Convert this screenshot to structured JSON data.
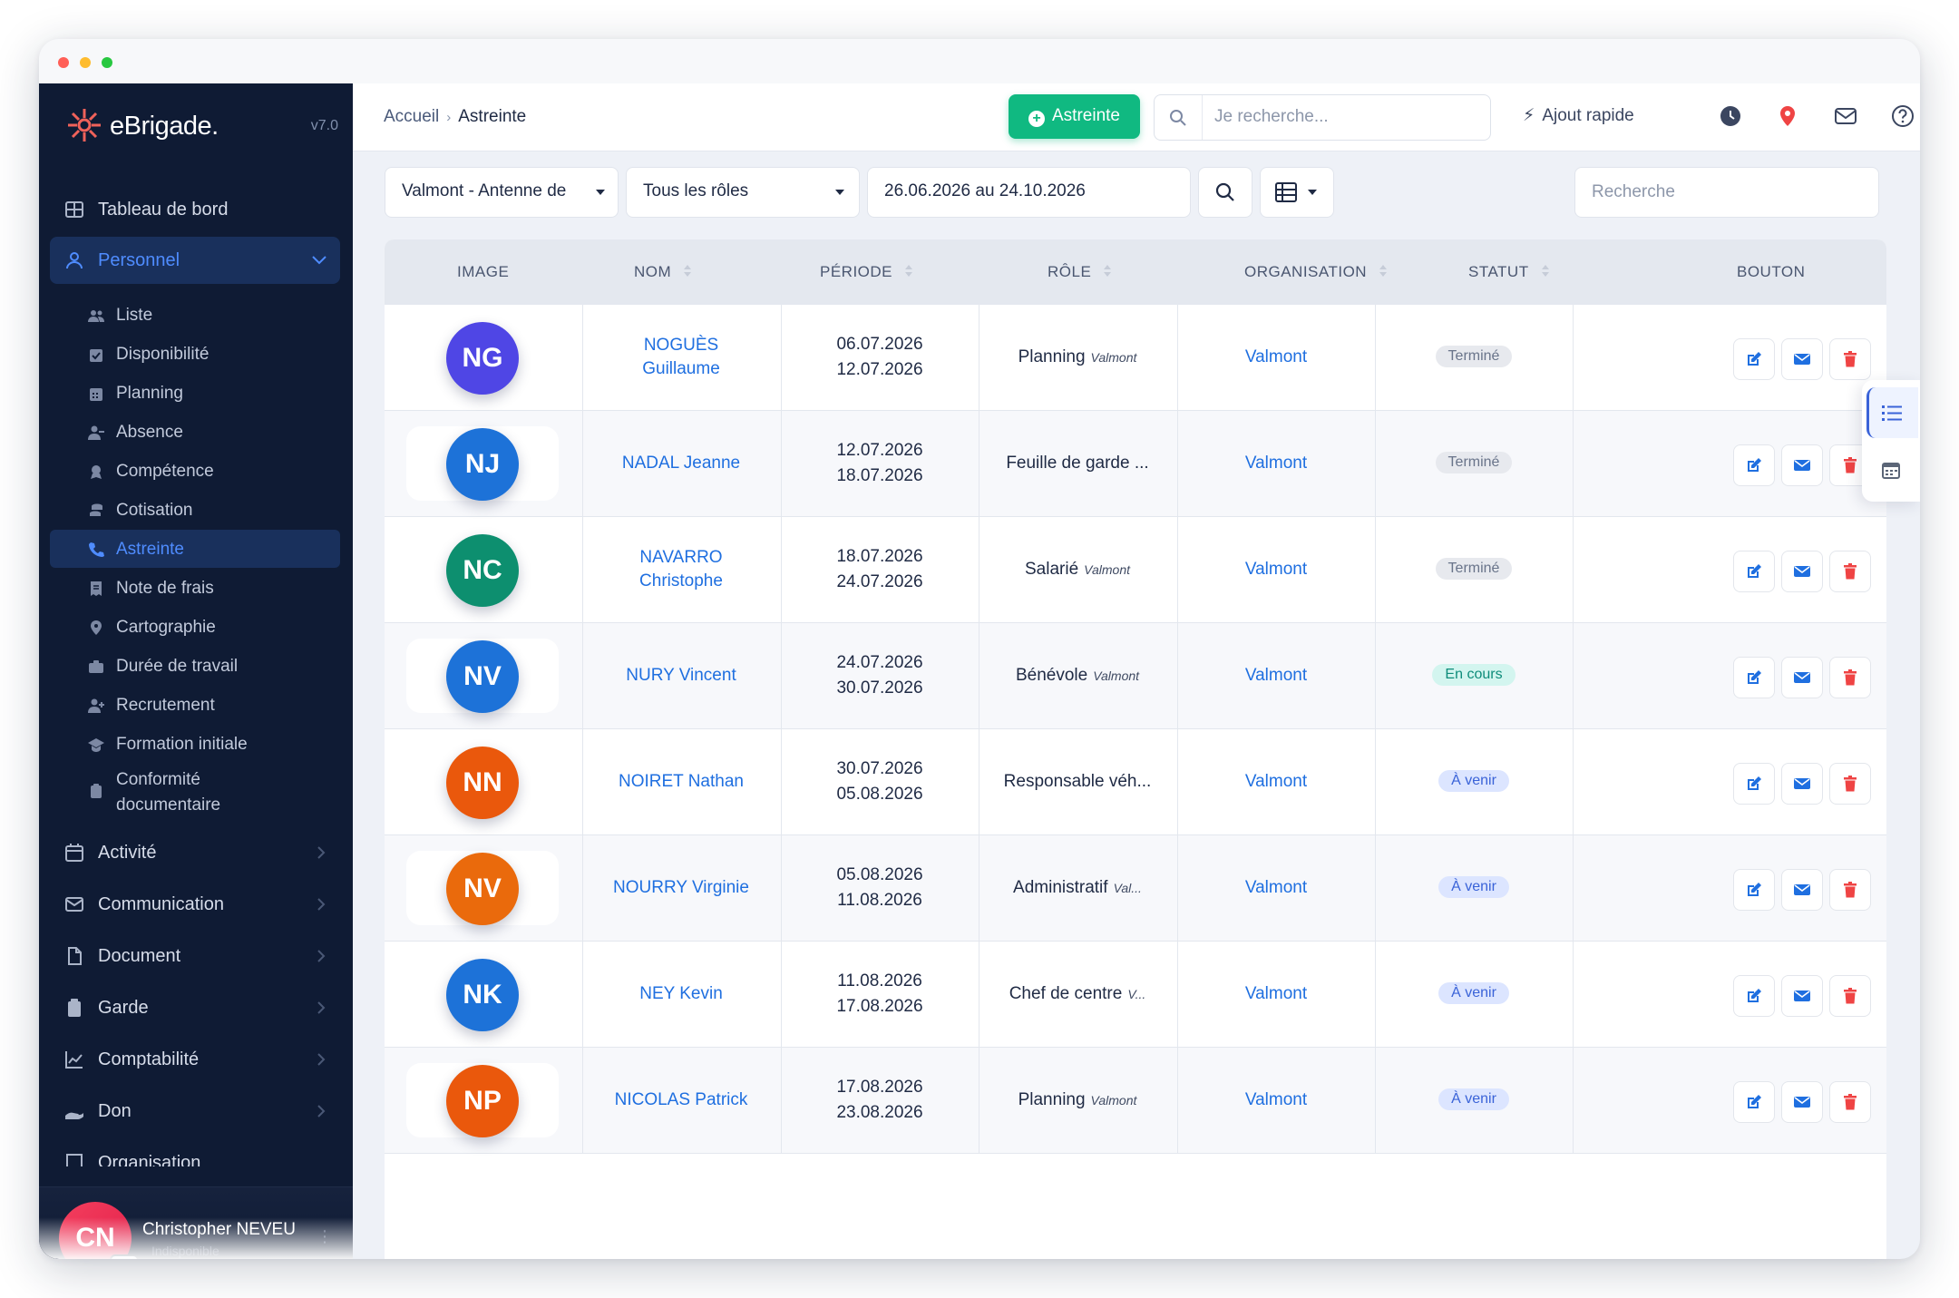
{
  "app": {
    "brand": "eBrigade.",
    "version": "v7.0"
  },
  "sidebar": {
    "items": [
      {
        "label": "Tableau de bord",
        "icon": "grid-icon"
      },
      {
        "label": "Personnel",
        "icon": "user-icon",
        "active": true
      }
    ],
    "sub_items": [
      {
        "label": "Liste",
        "icon": "users-icon"
      },
      {
        "label": "Disponibilité",
        "icon": "calendar-check-icon"
      },
      {
        "label": "Planning",
        "icon": "calendar-icon"
      },
      {
        "label": "Absence",
        "icon": "user-minus-icon"
      },
      {
        "label": "Compétence",
        "icon": "award-icon"
      },
      {
        "label": "Cotisation",
        "icon": "coins-icon"
      },
      {
        "label": "Astreinte",
        "icon": "phone-icon",
        "active": true
      },
      {
        "label": "Note de frais",
        "icon": "receipt-icon"
      },
      {
        "label": "Cartographie",
        "icon": "map-pin-icon"
      },
      {
        "label": "Durée de travail",
        "icon": "briefcase-icon"
      },
      {
        "label": "Recrutement",
        "icon": "user-plus-icon"
      },
      {
        "label": "Formation initiale",
        "icon": "graduation-icon"
      },
      {
        "label": "Conformité documentaire",
        "icon": "clipboard-icon"
      }
    ],
    "sections": [
      {
        "label": "Activité",
        "icon": "calendar-icon"
      },
      {
        "label": "Communication",
        "icon": "mail-icon"
      },
      {
        "label": "Document",
        "icon": "file-icon"
      },
      {
        "label": "Garde",
        "icon": "clipboard-icon"
      },
      {
        "label": "Comptabilité",
        "icon": "chart-line-icon"
      },
      {
        "label": "Don",
        "icon": "hand-icon"
      },
      {
        "label": "Organisation",
        "icon": "building-icon"
      }
    ],
    "user": {
      "initials": "CN",
      "name": "Christopher NEVEU",
      "status": "Indisponible"
    }
  },
  "topbar": {
    "breadcrumb": {
      "home": "Accueil",
      "separator": "›",
      "current": "Astreinte"
    },
    "primary_button": "Astreinte",
    "search_placeholder": "Je recherche...",
    "quick_add": "Ajout rapide"
  },
  "filters": {
    "section": "Valmont - Antenne de",
    "roles": "Tous les rôles",
    "period": "26.06.2026 au 24.10.2026",
    "search_placeholder": "Recherche"
  },
  "table": {
    "columns": [
      "IMAGE",
      "NOM",
      "PÉRIODE",
      "RÔLE",
      "ORGANISATION",
      "STATUT",
      "BOUTON"
    ],
    "rows": [
      {
        "initials": "NG",
        "color": "#4f46e5",
        "name_line1": "NOGUÈS",
        "name_line2": "Guillaume",
        "start": "06.07.2026",
        "end": "12.07.2026",
        "role": "Planning",
        "role_org": "Valmont",
        "org": "Valmont",
        "status": "Terminé",
        "status_kind": "done"
      },
      {
        "initials": "NJ",
        "color": "#1d72d8",
        "name_line1": "NADAL Jeanne",
        "name_line2": "",
        "start": "12.07.2026",
        "end": "18.07.2026",
        "role": "Feuille de garde ...",
        "role_org": "",
        "org": "Valmont",
        "status": "Terminé",
        "status_kind": "done"
      },
      {
        "initials": "NC",
        "color": "#0d8f6f",
        "name_line1": "NAVARRO",
        "name_line2": "Christophe",
        "start": "18.07.2026",
        "end": "24.07.2026",
        "role": "Salarié",
        "role_org": "Valmont",
        "org": "Valmont",
        "status": "Terminé",
        "status_kind": "done"
      },
      {
        "initials": "NV",
        "color": "#1d72d8",
        "name_line1": "NURY Vincent",
        "name_line2": "",
        "start": "24.07.2026",
        "end": "30.07.2026",
        "role": "Bénévole",
        "role_org": "Valmont",
        "org": "Valmont",
        "status": "En cours",
        "status_kind": "current"
      },
      {
        "initials": "NN",
        "color": "#ea580c",
        "name_line1": "NOIRET Nathan",
        "name_line2": "",
        "start": "30.07.2026",
        "end": "05.08.2026",
        "role": "Responsable véh...",
        "role_org": "",
        "org": "Valmont",
        "status": "À venir",
        "status_kind": "next"
      },
      {
        "initials": "NV",
        "color": "#ea6a0c",
        "name_line1": "NOURRY Virginie",
        "name_line2": "",
        "start": "05.08.2026",
        "end": "11.08.2026",
        "role": "Administratif",
        "role_org": "Val...",
        "org": "Valmont",
        "status": "À venir",
        "status_kind": "next"
      },
      {
        "initials": "NK",
        "color": "#1d72d8",
        "name_line1": "NEY Kevin",
        "name_line2": "",
        "start": "11.08.2026",
        "end": "17.08.2026",
        "role": "Chef de centre",
        "role_org": "V...",
        "org": "Valmont",
        "status": "À venir",
        "status_kind": "next"
      },
      {
        "initials": "NP",
        "color": "#ea580c",
        "name_line1": "NICOLAS Patrick",
        "name_line2": "",
        "start": "17.08.2026",
        "end": "23.08.2026",
        "role": "Planning",
        "role_org": "Valmont",
        "org": "Valmont",
        "status": "À venir",
        "status_kind": "next"
      }
    ]
  },
  "colors": {
    "sidebar_bg": "#0f1b34",
    "accent": "#4f8cff",
    "success": "#10b981",
    "danger": "#ef4444",
    "link": "#1f6fe0"
  }
}
